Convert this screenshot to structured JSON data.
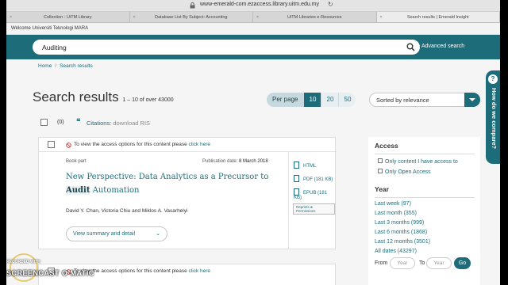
{
  "browser": {
    "url": "www-emerald-com.ezaccess.library.uitm.edu.my",
    "tabs": [
      "Collection - UiTM Library",
      "Database List By Subject: Accounting",
      "UiTM Libraries e-Resources",
      "Search results | Emerald Insight"
    ]
  },
  "header": {
    "welcome": "Welcome Universiti Teknologi MARA",
    "search_value": "Auditing",
    "advanced": "Advanced search"
  },
  "breadcrumb": {
    "home": "Home",
    "sep": "/",
    "current": "Search results"
  },
  "results": {
    "title": "Search results",
    "range": "1 – 10 of over 43000",
    "per_page_label": "Per page",
    "per_page_options": [
      "10",
      "20",
      "50"
    ],
    "sort": "Sorted by relevance",
    "selected_count": "(0)",
    "citations_label": "Citations:",
    "citations_action": "download RIS"
  },
  "item1": {
    "access_text": "To view the access options for this content please",
    "access_link": "click here",
    "type": "Book part",
    "pubdate_label": "Publication date:",
    "pubdate": "8 March 2018",
    "title_pre": "New Perspective: Data Analytics as a Precursor to",
    "title_hl": "Audit",
    "title_post": "Automation",
    "authors": "David Y. Chan, Victoria Chiu and Miklos A. Vasarhelyi",
    "view_summary": "View summary and detail",
    "formats": [
      "HTML",
      "PDF (181 KB)",
      "EPUB (181 KB)"
    ],
    "reprints": "Reprints & Permissions"
  },
  "item2": {
    "access_text": "To view the access options for this content please",
    "access_link": "click here"
  },
  "sidebar": {
    "access_heading": "Access",
    "access_options": [
      "Only content I have access to",
      "Only Open Access"
    ],
    "year_heading": "Year",
    "years": [
      "Last week (97)",
      "Last month (355)",
      "Last 3 months (999)",
      "Last 6 months (1868)",
      "Last 12 months (3501)",
      "All dates (43297)"
    ],
    "from": "From",
    "to": "To",
    "year_placeholder": "Year",
    "go": "Go"
  },
  "compare": {
    "label": "How do we compare?",
    "q": "?"
  },
  "watermark": {
    "line1": "RECORDED WITH",
    "line2": "SCREENCAST O MATIC"
  },
  "colors": {
    "brand": "#1c6d79",
    "accent": "#2b8a94",
    "warning": "#cc3333"
  }
}
